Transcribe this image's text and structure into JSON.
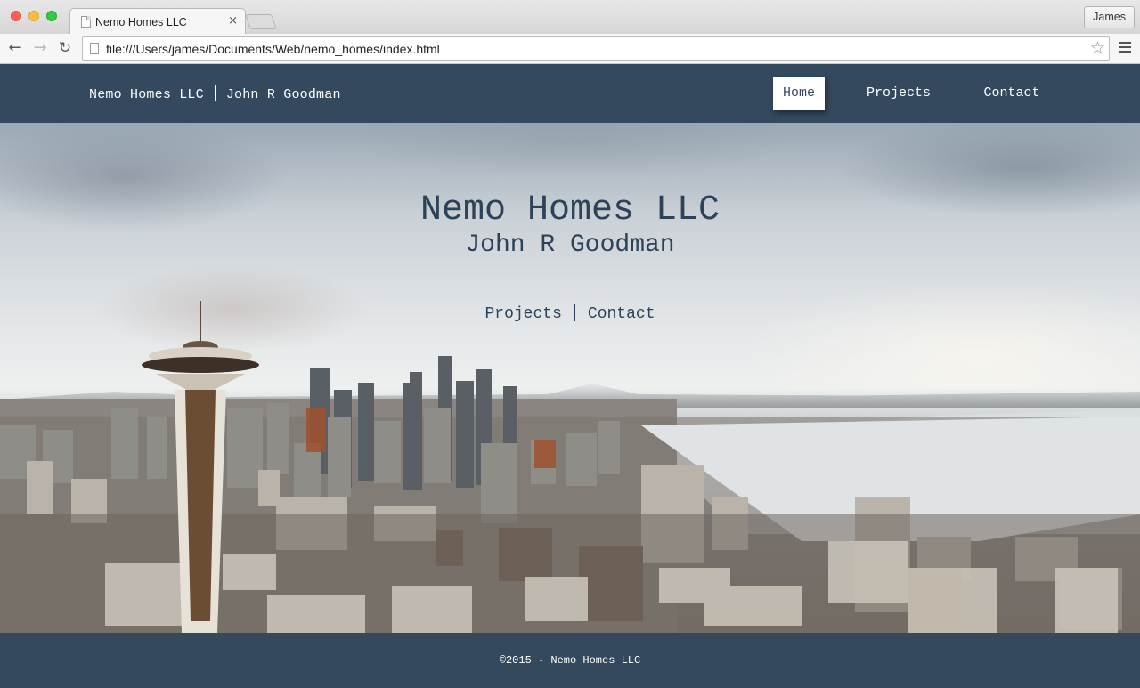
{
  "browser": {
    "tab_title": "Nemo Homes LLC",
    "tab_close": "×",
    "profile_name": "James",
    "url": "file:///Users/james/Documents/Web/nemo_homes/index.html",
    "icons": {
      "back": "←",
      "forward": "→",
      "reload": "↻",
      "bookmark": "☆"
    }
  },
  "site": {
    "brand_name": "Nemo Homes LLC",
    "brand_owner": "John R Goodman",
    "nav": {
      "home": "Home",
      "projects": "Projects",
      "contact": "Contact",
      "active": "Home"
    },
    "hero": {
      "title": "Nemo Homes LLC",
      "subtitle": "John R Goodman",
      "link_projects": "Projects",
      "link_contact": "Contact"
    },
    "footer": "©2015 - Nemo Homes LLC",
    "colors": {
      "header_bg": "#34495e",
      "hero_text": "#2d4258"
    }
  }
}
